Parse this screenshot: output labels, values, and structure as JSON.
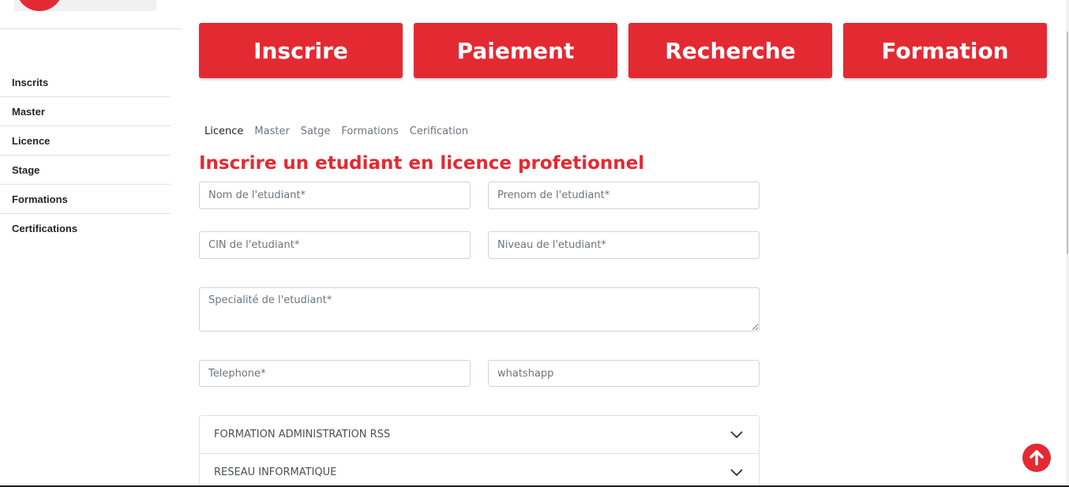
{
  "sidebar": {
    "items": [
      "Inscrits",
      "Master",
      "Licence",
      "Stage",
      "Formations",
      "Certifications"
    ]
  },
  "actions": {
    "buttons": [
      "Inscrire",
      "Paiement",
      "Recherche",
      "Formation"
    ]
  },
  "tabs": {
    "items": [
      "Licence",
      "Master",
      "Satge",
      "Formations",
      "Cerification"
    ],
    "active": "Licence"
  },
  "form": {
    "title": "Inscrire un etudiant en licence profetionnel",
    "nom_placeholder": "Nom de l'etudiant*",
    "prenom_placeholder": "Prenom de l'etudiant*",
    "cin_placeholder": "CIN de l'etudiant*",
    "niveau_placeholder": "Niveau de l'etudiant*",
    "specialite_placeholder": "Specialité de l'etudiant*",
    "telephone_placeholder": "Telephone*",
    "whatsapp_placeholder": "whatshapp"
  },
  "accordion": {
    "items": [
      "FORMATION ADMINISTRATION RSS",
      "RESEAU INFORMATIQUE"
    ]
  },
  "icons": {
    "chevron": "chevron-down-icon",
    "scroll_top": "arrow-up-icon"
  },
  "colors": {
    "accent": "#e32a33"
  }
}
